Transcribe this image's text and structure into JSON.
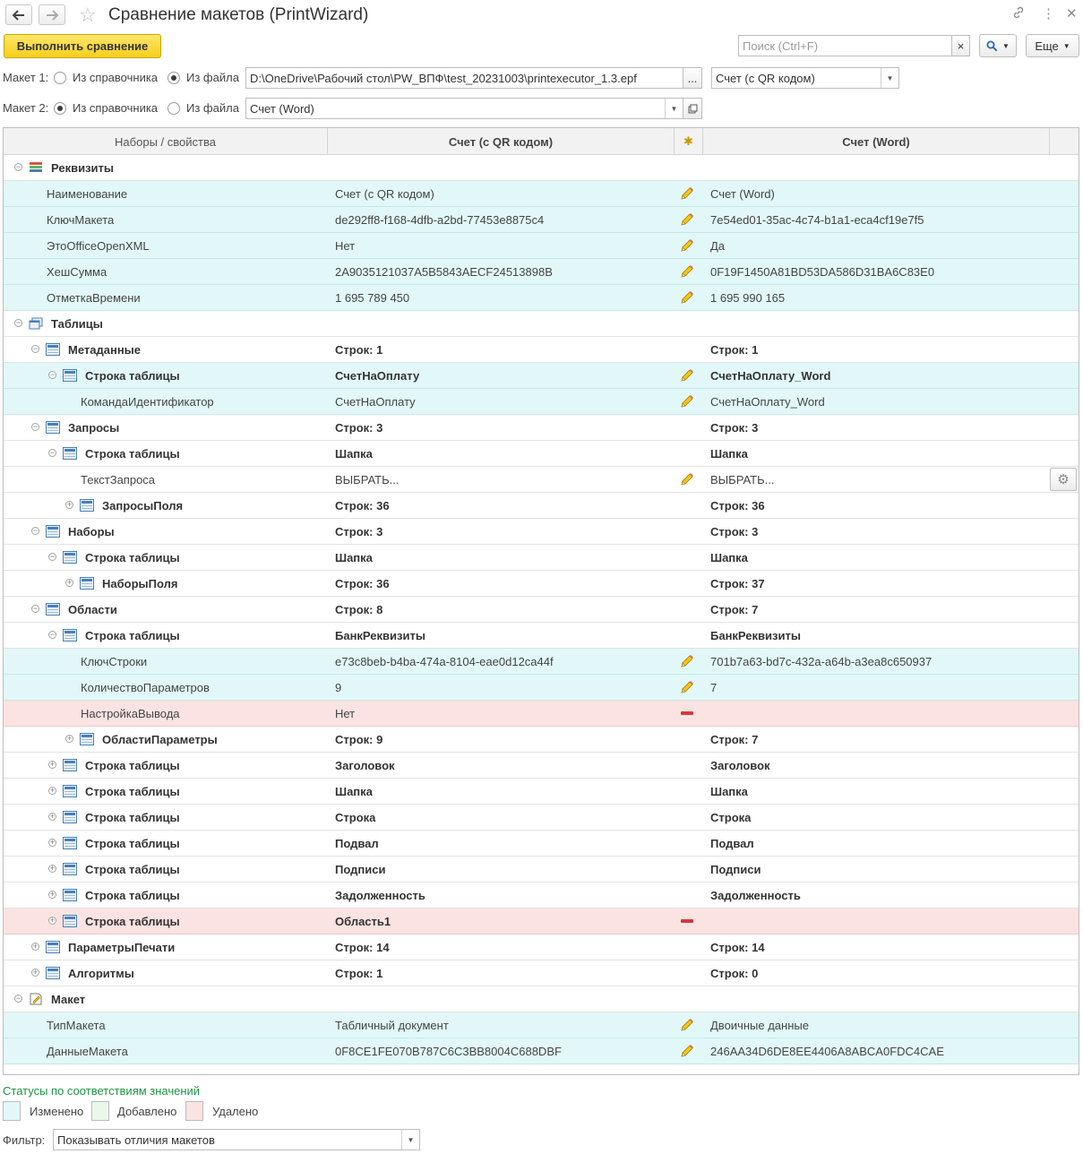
{
  "window": {
    "title": "Сравнение макетов (PrintWizard)",
    "icons": [
      "arrow-left-icon",
      "arrow-right-icon",
      "star-icon",
      "link-icon",
      "more-vert-icon",
      "close-icon"
    ]
  },
  "toolbar": {
    "run_compare": "Выполнить сравнение",
    "search_placeholder": "Поиск (Ctrl+F)",
    "search_clear": "×",
    "search_button": "🔍",
    "more": "Еще"
  },
  "layout1": {
    "label": "Макет 1:",
    "option_catalog": "Из справочника",
    "option_file": "Из файла",
    "selected": "Из файла",
    "file_path": "D:\\OneDrive\\Рабочий стол\\PW_ВПФ\\test_20231003\\printexecutor_1.3.epf",
    "browse": "...",
    "template": "Счет (с QR кодом)"
  },
  "layout2": {
    "label": "Макет 2:",
    "option_catalog": "Из справочника",
    "option_file": "Из файла",
    "selected": "Из справочника",
    "template": "Счет (Word)"
  },
  "table": {
    "columns": [
      "Наборы / свойства",
      "Счет (с QR кодом)",
      "*",
      "Счет (Word)"
    ],
    "rows": [
      {
        "level": 0,
        "toggle": "minus",
        "icon": "requisites-icon",
        "bold": true,
        "label": "Реквизиты",
        "v1": "",
        "status": "",
        "v2": ""
      },
      {
        "level": 1,
        "toggle": "",
        "icon": "",
        "bold": false,
        "state": "mod",
        "label": "Наименование",
        "v1": "Счет (с QR кодом)",
        "status": "changed",
        "v2": "Счет (Word)"
      },
      {
        "level": 1,
        "toggle": "",
        "icon": "",
        "bold": false,
        "state": "mod",
        "label": "КлючМакета",
        "v1": "de292ff8-f168-4dfb-a2bd-77453e8875c4",
        "status": "changed",
        "v2": "7e54ed01-35ac-4c74-b1a1-eca4cf19e7f5"
      },
      {
        "level": 1,
        "toggle": "",
        "icon": "",
        "bold": false,
        "state": "mod",
        "label": "ЭтоOfficeOpenXML",
        "v1": "Нет",
        "status": "changed",
        "v2": "Да"
      },
      {
        "level": 1,
        "toggle": "",
        "icon": "",
        "bold": false,
        "state": "mod",
        "label": "ХешСумма",
        "v1": "2A9035121037A5B5843AECF24513898B",
        "status": "changed",
        "v2": "0F19F1450A81BD53DA586D31BA6C83E0"
      },
      {
        "level": 1,
        "toggle": "",
        "icon": "",
        "bold": false,
        "state": "mod",
        "label": "ОтметкаВремени",
        "v1": "1 695 789 450",
        "status": "changed",
        "v2": "1 695 990 165"
      },
      {
        "level": 0,
        "toggle": "minus",
        "icon": "tables-icon",
        "bold": true,
        "label": "Таблицы",
        "v1": "",
        "status": "",
        "v2": ""
      },
      {
        "level": 1,
        "toggle": "minus",
        "icon": "table-icon",
        "bold": true,
        "label": "Метаданные",
        "v1": "Строк: 1",
        "status": "",
        "v2": "Строк: 1"
      },
      {
        "level": 2,
        "toggle": "minus",
        "icon": "table-row-icon",
        "bold": true,
        "state": "mod",
        "label": "Строка таблицы",
        "v1": "СчетНаОплату",
        "status": "changed",
        "v2": "СчетНаОплату_Word"
      },
      {
        "level": 3,
        "toggle": "",
        "icon": "",
        "bold": false,
        "state": "mod",
        "label": "КомандаИдентификатор",
        "v1": "СчетНаОплату",
        "status": "changed",
        "v2": "СчетНаОплату_Word"
      },
      {
        "level": 1,
        "toggle": "minus",
        "icon": "table-icon",
        "bold": true,
        "label": "Запросы",
        "v1": "Строк: 3",
        "status": "",
        "v2": "Строк: 3"
      },
      {
        "level": 2,
        "toggle": "minus",
        "icon": "table-row-icon",
        "bold": true,
        "label": "Строка таблицы",
        "v1": "Шапка",
        "status": "",
        "v2": "Шапка"
      },
      {
        "level": 3,
        "toggle": "",
        "icon": "",
        "bold": false,
        "label": "ТекстЗапроса",
        "v1": "ВЫБРАТЬ...",
        "status": "changed",
        "v2": "ВЫБРАТЬ...",
        "gear": true
      },
      {
        "level": 3,
        "toggle": "plus",
        "icon": "table-icon",
        "bold": true,
        "label": "ЗапросыПоля",
        "v1": "Строк: 36",
        "status": "",
        "v2": "Строк: 36"
      },
      {
        "level": 1,
        "toggle": "minus",
        "icon": "table-icon",
        "bold": true,
        "label": "Наборы",
        "v1": "Строк: 3",
        "status": "",
        "v2": "Строк: 3"
      },
      {
        "level": 2,
        "toggle": "minus",
        "icon": "table-row-icon",
        "bold": true,
        "label": "Строка таблицы",
        "v1": "Шапка",
        "status": "",
        "v2": "Шапка"
      },
      {
        "level": 3,
        "toggle": "plus",
        "icon": "table-icon",
        "bold": true,
        "label": "НаборыПоля",
        "v1": "Строк: 36",
        "status": "",
        "v2": "Строк: 37"
      },
      {
        "level": 1,
        "toggle": "minus",
        "icon": "table-icon",
        "bold": true,
        "label": "Области",
        "v1": "Строк: 8",
        "status": "",
        "v2": "Строк: 7"
      },
      {
        "level": 2,
        "toggle": "minus",
        "icon": "table-row-icon",
        "bold": true,
        "label": "Строка таблицы",
        "v1": "БанкРеквизиты",
        "status": "",
        "v2": "БанкРеквизиты"
      },
      {
        "level": 3,
        "toggle": "",
        "icon": "",
        "bold": false,
        "state": "mod",
        "label": "КлючСтроки",
        "v1": "e73c8beb-b4ba-474a-8104-eae0d12ca44f",
        "status": "changed",
        "v2": "701b7a63-bd7c-432a-a64b-a3ea8c650937"
      },
      {
        "level": 3,
        "toggle": "",
        "icon": "",
        "bold": false,
        "state": "mod",
        "label": "КоличествоПараметров",
        "v1": "9",
        "status": "changed",
        "v2": "7"
      },
      {
        "level": 3,
        "toggle": "",
        "icon": "",
        "bold": false,
        "state": "del",
        "label": "НастройкаВывода",
        "v1": "Нет",
        "status": "deleted",
        "v2": ""
      },
      {
        "level": 3,
        "toggle": "plus",
        "icon": "table-icon",
        "bold": true,
        "label": "ОбластиПараметры",
        "v1": "Строк: 9",
        "status": "",
        "v2": "Строк: 7"
      },
      {
        "level": 2,
        "toggle": "plus",
        "icon": "table-row-icon",
        "bold": true,
        "label": "Строка таблицы",
        "v1": "Заголовок",
        "status": "",
        "v2": "Заголовок"
      },
      {
        "level": 2,
        "toggle": "plus",
        "icon": "table-row-icon",
        "bold": true,
        "label": "Строка таблицы",
        "v1": "Шапка",
        "status": "",
        "v2": "Шапка"
      },
      {
        "level": 2,
        "toggle": "plus",
        "icon": "table-row-icon",
        "bold": true,
        "label": "Строка таблицы",
        "v1": "Строка",
        "status": "",
        "v2": "Строка"
      },
      {
        "level": 2,
        "toggle": "plus",
        "icon": "table-row-icon",
        "bold": true,
        "label": "Строка таблицы",
        "v1": "Подвал",
        "status": "",
        "v2": "Подвал"
      },
      {
        "level": 2,
        "toggle": "plus",
        "icon": "table-row-icon",
        "bold": true,
        "label": "Строка таблицы",
        "v1": "Подписи",
        "status": "",
        "v2": "Подписи"
      },
      {
        "level": 2,
        "toggle": "plus",
        "icon": "table-row-icon",
        "bold": true,
        "label": "Строка таблицы",
        "v1": "Задолженность",
        "status": "",
        "v2": "Задолженность"
      },
      {
        "level": 2,
        "toggle": "plus",
        "icon": "table-row-icon",
        "bold": true,
        "state": "del",
        "label": "Строка таблицы",
        "v1": "Область1",
        "status": "deleted",
        "v2": ""
      },
      {
        "level": 1,
        "toggle": "plus",
        "icon": "table-icon",
        "bold": true,
        "label": "ПараметрыПечати",
        "v1": "Строк: 14",
        "status": "",
        "v2": "Строк: 14"
      },
      {
        "level": 1,
        "toggle": "plus",
        "icon": "table-icon",
        "bold": true,
        "label": "Алгоритмы",
        "v1": "Строк: 1",
        "status": "",
        "v2": "Строк: 0"
      },
      {
        "level": 0,
        "toggle": "minus",
        "icon": "layout-icon",
        "bold": true,
        "label": "Макет",
        "v1": "",
        "status": "",
        "v2": ""
      },
      {
        "level": 1,
        "toggle": "",
        "icon": "",
        "bold": false,
        "state": "mod",
        "label": "ТипМакета",
        "v1": "Табличный документ",
        "status": "changed",
        "v2": "Двоичные данные"
      },
      {
        "level": 1,
        "toggle": "",
        "icon": "",
        "bold": false,
        "state": "mod",
        "label": "ДанныеМакета",
        "v1": "0F8CE1FE070B787C6C3BB8004C688DBF",
        "status": "changed",
        "v2": "246AA34D6DE8EE4406A8ABCA0FDC4CAE"
      }
    ]
  },
  "legend": {
    "title": "Статусы по соответствиям значений",
    "changed": "Изменено",
    "added": "Добавлено",
    "deleted": "Удалено",
    "colors": {
      "changed": "#e2f8f8",
      "added": "#eaf8ea",
      "deleted": "#fbe3e2"
    }
  },
  "filter": {
    "label": "Фильтр:",
    "value": "Показывать отличия макетов"
  }
}
